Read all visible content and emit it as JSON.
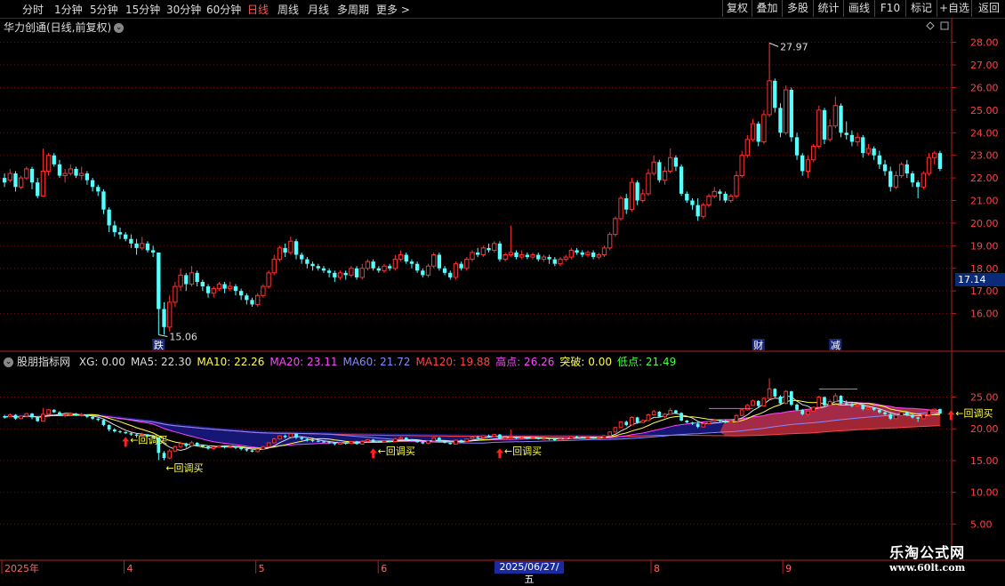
{
  "toolbar": {
    "periods": [
      "分时",
      "1分钟",
      "5分钟",
      "15分钟",
      "30分钟",
      "60分钟",
      "日线",
      "周线",
      "月线",
      "多周期",
      "更多"
    ],
    "active": "日线",
    "right_buttons": [
      "复权",
      "叠加",
      "多股",
      "统计",
      "画线",
      "F10",
      "标记",
      "+自选",
      "返回"
    ]
  },
  "stock_title": "华力创通(日线,前复权)",
  "price_axis": {
    "ticks": [
      "28.00",
      "27.00",
      "26.00",
      "25.00",
      "24.00",
      "23.00",
      "22.00",
      "21.00",
      "20.00",
      "19.00",
      "18.00",
      "17.00",
      "16.00"
    ],
    "current": "17.14"
  },
  "ind_axis": {
    "ticks": [
      "25.00",
      "20.00",
      "15.00",
      "10.00",
      "5.00"
    ]
  },
  "indicator": {
    "name": "股朋指标网",
    "items": [
      {
        "label": "XG: 0.00",
        "color": "#dddddd"
      },
      {
        "label": "MA5: 22.30",
        "color": "#dddddd"
      },
      {
        "label": "MA10: 22.26",
        "color": "#ffff44"
      },
      {
        "label": "MA20: 23.11",
        "color": "#ff44ff"
      },
      {
        "label": "MA60: 21.72",
        "color": "#8888ff"
      },
      {
        "label": "MA120: 19.88",
        "color": "#ff4444"
      },
      {
        "label": "高点: 26.26",
        "color": "#ff44ff"
      },
      {
        "label": "突破: 0.00",
        "color": "#ffff44"
      },
      {
        "label": "低点: 21.49",
        "color": "#44ff44"
      }
    ]
  },
  "annotations": {
    "high": "27.97",
    "low": "15.06",
    "die": "跌",
    "cai": "财",
    "jian": "减",
    "buy": "回调买",
    "buy_arrow": "←回调买"
  },
  "date_axis": {
    "labels": [
      "2025年",
      "4",
      "5",
      "6",
      "8",
      "9"
    ],
    "cursor": "2025/06/27/五"
  },
  "watermark": {
    "line1": "乐淘公式网",
    "line2": "www.60lt.com"
  },
  "chart_data": {
    "type": "candlestick",
    "title": "华力创通(日线,前复权)",
    "ylim": [
      15.0,
      28.3
    ],
    "ind_ylim": [
      3.5,
      29.0
    ],
    "candles": [
      [
        22.0,
        21.8,
        22.2,
        21.6
      ],
      [
        21.9,
        22.2,
        22.4,
        21.8
      ],
      [
        22.2,
        21.6,
        22.3,
        21.4
      ],
      [
        21.6,
        22.0,
        22.1,
        21.5
      ],
      [
        22.0,
        22.4,
        22.5,
        21.9
      ],
      [
        22.4,
        21.8,
        22.5,
        21.5
      ],
      [
        21.8,
        21.2,
        22.0,
        21.1
      ],
      [
        21.2,
        22.3,
        23.3,
        21.2
      ],
      [
        22.3,
        23.0,
        23.1,
        22.1
      ],
      [
        23.0,
        22.6,
        23.1,
        22.5
      ],
      [
        22.6,
        22.1,
        22.8,
        22.0
      ],
      [
        22.1,
        22.2,
        22.4,
        21.8
      ],
      [
        22.2,
        22.4,
        22.6,
        22.1
      ],
      [
        22.4,
        22.1,
        22.5,
        22.0
      ],
      [
        22.1,
        22.2,
        22.5,
        21.9
      ],
      [
        22.2,
        21.9,
        22.3,
        21.7
      ],
      [
        21.9,
        21.6,
        22.0,
        21.4
      ],
      [
        21.6,
        21.4,
        21.7,
        21.2
      ],
      [
        21.4,
        20.6,
        21.5,
        20.4
      ],
      [
        20.6,
        19.9,
        20.7,
        19.6
      ],
      [
        19.9,
        19.6,
        20.1,
        19.4
      ],
      [
        19.6,
        19.5,
        19.8,
        19.3
      ],
      [
        19.5,
        19.3,
        19.6,
        19.2
      ],
      [
        19.3,
        19.1,
        19.5,
        18.9
      ],
      [
        19.1,
        18.9,
        19.3,
        18.6
      ],
      [
        18.9,
        19.1,
        19.4,
        18.8
      ],
      [
        19.1,
        18.8,
        19.2,
        18.7
      ],
      [
        18.8,
        18.7,
        19.0,
        18.5
      ],
      [
        18.7,
        16.2,
        18.7,
        15.06
      ],
      [
        16.2,
        15.4,
        16.5,
        15.06
      ],
      [
        15.4,
        16.5,
        16.8,
        15.2
      ],
      [
        16.5,
        17.2,
        17.4,
        16.3
      ],
      [
        17.2,
        17.7,
        18.0,
        17.0
      ],
      [
        17.7,
        17.3,
        17.8,
        17.0
      ],
      [
        17.3,
        17.8,
        18.1,
        17.2
      ],
      [
        17.8,
        17.4,
        17.9,
        17.2
      ],
      [
        17.4,
        17.2,
        17.5,
        17.0
      ],
      [
        17.2,
        16.9,
        17.3,
        16.7
      ],
      [
        16.9,
        17.1,
        17.2,
        16.7
      ],
      [
        17.1,
        17.3,
        17.4,
        17.0
      ],
      [
        17.3,
        17.1,
        17.4,
        16.9
      ],
      [
        17.1,
        17.2,
        17.4,
        17.0
      ],
      [
        17.2,
        17.0,
        17.3,
        16.8
      ],
      [
        17.0,
        16.8,
        17.1,
        16.6
      ],
      [
        16.8,
        16.6,
        16.9,
        16.4
      ],
      [
        16.6,
        16.4,
        16.7,
        16.3
      ],
      [
        16.4,
        16.8,
        16.9,
        16.3
      ],
      [
        16.8,
        17.2,
        17.3,
        16.7
      ],
      [
        17.2,
        17.8,
        17.9,
        17.1
      ],
      [
        17.8,
        18.4,
        18.6,
        17.7
      ],
      [
        18.4,
        18.9,
        19.0,
        18.3
      ],
      [
        18.9,
        18.7,
        19.1,
        18.5
      ],
      [
        18.7,
        19.2,
        19.4,
        18.6
      ],
      [
        19.2,
        18.6,
        19.3,
        18.4
      ],
      [
        18.6,
        18.4,
        18.7,
        18.2
      ],
      [
        18.4,
        18.2,
        18.5,
        18.0
      ],
      [
        18.2,
        18.1,
        18.3,
        17.9
      ],
      [
        18.1,
        18.0,
        18.2,
        17.9
      ],
      [
        18.0,
        17.9,
        18.1,
        17.8
      ],
      [
        17.9,
        17.8,
        18.0,
        17.6
      ],
      [
        17.8,
        17.6,
        17.9,
        17.4
      ],
      [
        17.6,
        17.8,
        17.9,
        17.5
      ],
      [
        17.8,
        17.7,
        17.9,
        17.5
      ],
      [
        17.7,
        18.0,
        18.1,
        17.6
      ],
      [
        18.0,
        17.6,
        18.1,
        17.5
      ],
      [
        17.6,
        18.0,
        18.2,
        17.5
      ],
      [
        18.0,
        18.3,
        18.4,
        17.9
      ],
      [
        18.3,
        18.0,
        18.4,
        17.9
      ],
      [
        18.0,
        17.9,
        18.1,
        17.8
      ],
      [
        17.9,
        18.1,
        18.2,
        17.8
      ],
      [
        18.1,
        18.0,
        18.2,
        17.9
      ],
      [
        18.0,
        18.4,
        18.6,
        17.9
      ],
      [
        18.4,
        18.6,
        18.8,
        18.3
      ],
      [
        18.6,
        18.3,
        18.7,
        18.2
      ],
      [
        18.3,
        18.2,
        18.4,
        18.0
      ],
      [
        18.2,
        17.9,
        18.3,
        17.8
      ],
      [
        17.9,
        17.7,
        18.0,
        17.6
      ],
      [
        17.7,
        18.1,
        18.2,
        17.6
      ],
      [
        18.1,
        18.6,
        18.7,
        18.0
      ],
      [
        18.6,
        18.0,
        18.7,
        17.9
      ],
      [
        18.0,
        17.8,
        18.1,
        17.7
      ],
      [
        17.8,
        17.6,
        17.9,
        17.5
      ],
      [
        17.6,
        18.2,
        18.3,
        17.5
      ],
      [
        18.2,
        18.0,
        18.3,
        17.9
      ],
      [
        18.0,
        18.4,
        18.5,
        17.9
      ],
      [
        18.4,
        18.7,
        18.8,
        18.3
      ],
      [
        18.7,
        18.6,
        18.9,
        18.5
      ],
      [
        18.6,
        18.9,
        19.0,
        18.5
      ],
      [
        18.9,
        18.8,
        19.1,
        18.7
      ],
      [
        18.8,
        19.1,
        19.2,
        18.7
      ],
      [
        19.1,
        18.4,
        19.2,
        18.3
      ],
      [
        18.4,
        18.6,
        18.7,
        18.3
      ],
      [
        18.6,
        18.7,
        19.9,
        18.5
      ],
      [
        18.7,
        18.5,
        18.8,
        18.4
      ],
      [
        18.5,
        18.6,
        18.8,
        18.4
      ],
      [
        18.6,
        18.5,
        18.7,
        18.4
      ],
      [
        18.5,
        18.6,
        18.7,
        18.4
      ],
      [
        18.6,
        18.4,
        18.7,
        18.3
      ],
      [
        18.4,
        18.5,
        18.6,
        18.3
      ],
      [
        18.5,
        18.4,
        18.6,
        18.2
      ],
      [
        18.4,
        18.2,
        18.5,
        18.1
      ],
      [
        18.2,
        18.4,
        18.5,
        18.1
      ],
      [
        18.4,
        18.5,
        18.6,
        18.3
      ],
      [
        18.5,
        18.8,
        18.9,
        18.4
      ],
      [
        18.8,
        18.7,
        18.9,
        18.6
      ],
      [
        18.7,
        18.6,
        18.8,
        18.5
      ],
      [
        18.6,
        18.7,
        18.8,
        18.5
      ],
      [
        18.7,
        18.5,
        18.8,
        18.4
      ],
      [
        18.5,
        18.6,
        18.7,
        18.4
      ],
      [
        18.6,
        18.9,
        19.0,
        18.5
      ],
      [
        18.9,
        19.5,
        19.6,
        18.8
      ],
      [
        19.5,
        20.2,
        20.3,
        19.4
      ],
      [
        20.2,
        21.1,
        21.2,
        20.1
      ],
      [
        21.1,
        20.6,
        21.3,
        20.4
      ],
      [
        20.6,
        21.8,
        22.0,
        20.5
      ],
      [
        21.8,
        21.0,
        21.9,
        20.8
      ],
      [
        21.0,
        21.3,
        21.5,
        20.9
      ],
      [
        21.3,
        22.2,
        22.4,
        21.2
      ],
      [
        22.2,
        22.7,
        23.0,
        22.1
      ],
      [
        22.7,
        21.9,
        22.8,
        21.8
      ],
      [
        21.9,
        22.3,
        22.5,
        21.7
      ],
      [
        22.3,
        22.9,
        23.3,
        22.2
      ],
      [
        22.9,
        22.5,
        23.0,
        22.3
      ],
      [
        22.5,
        21.3,
        22.6,
        21.2
      ],
      [
        21.3,
        21.0,
        21.4,
        20.9
      ],
      [
        21.0,
        20.8,
        21.1,
        20.6
      ],
      [
        20.8,
        20.3,
        21.1,
        20.1
      ],
      [
        20.3,
        20.8,
        20.9,
        20.2
      ],
      [
        20.8,
        21.2,
        21.3,
        20.7
      ],
      [
        21.2,
        21.4,
        21.6,
        21.1
      ],
      [
        21.4,
        21.3,
        21.5,
        21.0
      ],
      [
        21.3,
        21.0,
        21.4,
        20.9
      ],
      [
        21.0,
        21.2,
        21.3,
        20.9
      ],
      [
        21.2,
        22.1,
        22.3,
        21.1
      ],
      [
        22.1,
        23.0,
        23.2,
        22.0
      ],
      [
        23.0,
        23.7,
        23.9,
        22.9
      ],
      [
        23.7,
        24.4,
        24.6,
        23.6
      ],
      [
        24.4,
        23.6,
        24.5,
        23.4
      ],
      [
        23.6,
        24.8,
        25.0,
        23.5
      ],
      [
        24.8,
        26.3,
        27.97,
        24.7
      ],
      [
        26.3,
        25.1,
        26.4,
        24.9
      ],
      [
        25.1,
        24.0,
        25.3,
        23.8
      ],
      [
        24.0,
        25.9,
        26.1,
        23.9
      ],
      [
        25.9,
        23.8,
        26.0,
        23.6
      ],
      [
        23.8,
        23.0,
        24.0,
        22.8
      ],
      [
        23.0,
        22.3,
        23.1,
        22.1
      ],
      [
        22.3,
        22.8,
        23.0,
        22.0
      ],
      [
        22.8,
        23.4,
        23.5,
        22.7
      ],
      [
        23.4,
        25.0,
        25.2,
        23.3
      ],
      [
        25.0,
        23.7,
        25.1,
        23.5
      ],
      [
        23.7,
        24.3,
        24.6,
        23.6
      ],
      [
        24.3,
        25.2,
        25.6,
        24.2
      ],
      [
        25.2,
        24.0,
        25.3,
        23.8
      ],
      [
        24.0,
        23.9,
        24.5,
        23.7
      ],
      [
        23.9,
        23.6,
        24.1,
        23.4
      ],
      [
        23.6,
        23.8,
        24.0,
        23.4
      ],
      [
        23.8,
        23.1,
        23.9,
        22.9
      ],
      [
        23.1,
        23.3,
        23.5,
        23.0
      ],
      [
        23.3,
        23.0,
        23.4,
        22.8
      ],
      [
        23.0,
        22.6,
        23.2,
        22.4
      ],
      [
        22.6,
        22.3,
        22.8,
        22.1
      ],
      [
        22.3,
        21.6,
        22.5,
        21.4
      ],
      [
        21.6,
        22.1,
        22.3,
        21.5
      ],
      [
        22.1,
        22.6,
        22.7,
        22.0
      ],
      [
        22.6,
        22.2,
        22.8,
        22.0
      ],
      [
        22.2,
        21.8,
        22.3,
        21.6
      ],
      [
        21.8,
        21.6,
        21.9,
        21.1
      ],
      [
        21.6,
        22.2,
        22.3,
        21.5
      ],
      [
        22.2,
        22.9,
        23.1,
        22.1
      ],
      [
        22.9,
        23.1,
        23.2,
        22.6
      ],
      [
        23.1,
        22.4,
        23.2,
        22.3
      ]
    ]
  }
}
